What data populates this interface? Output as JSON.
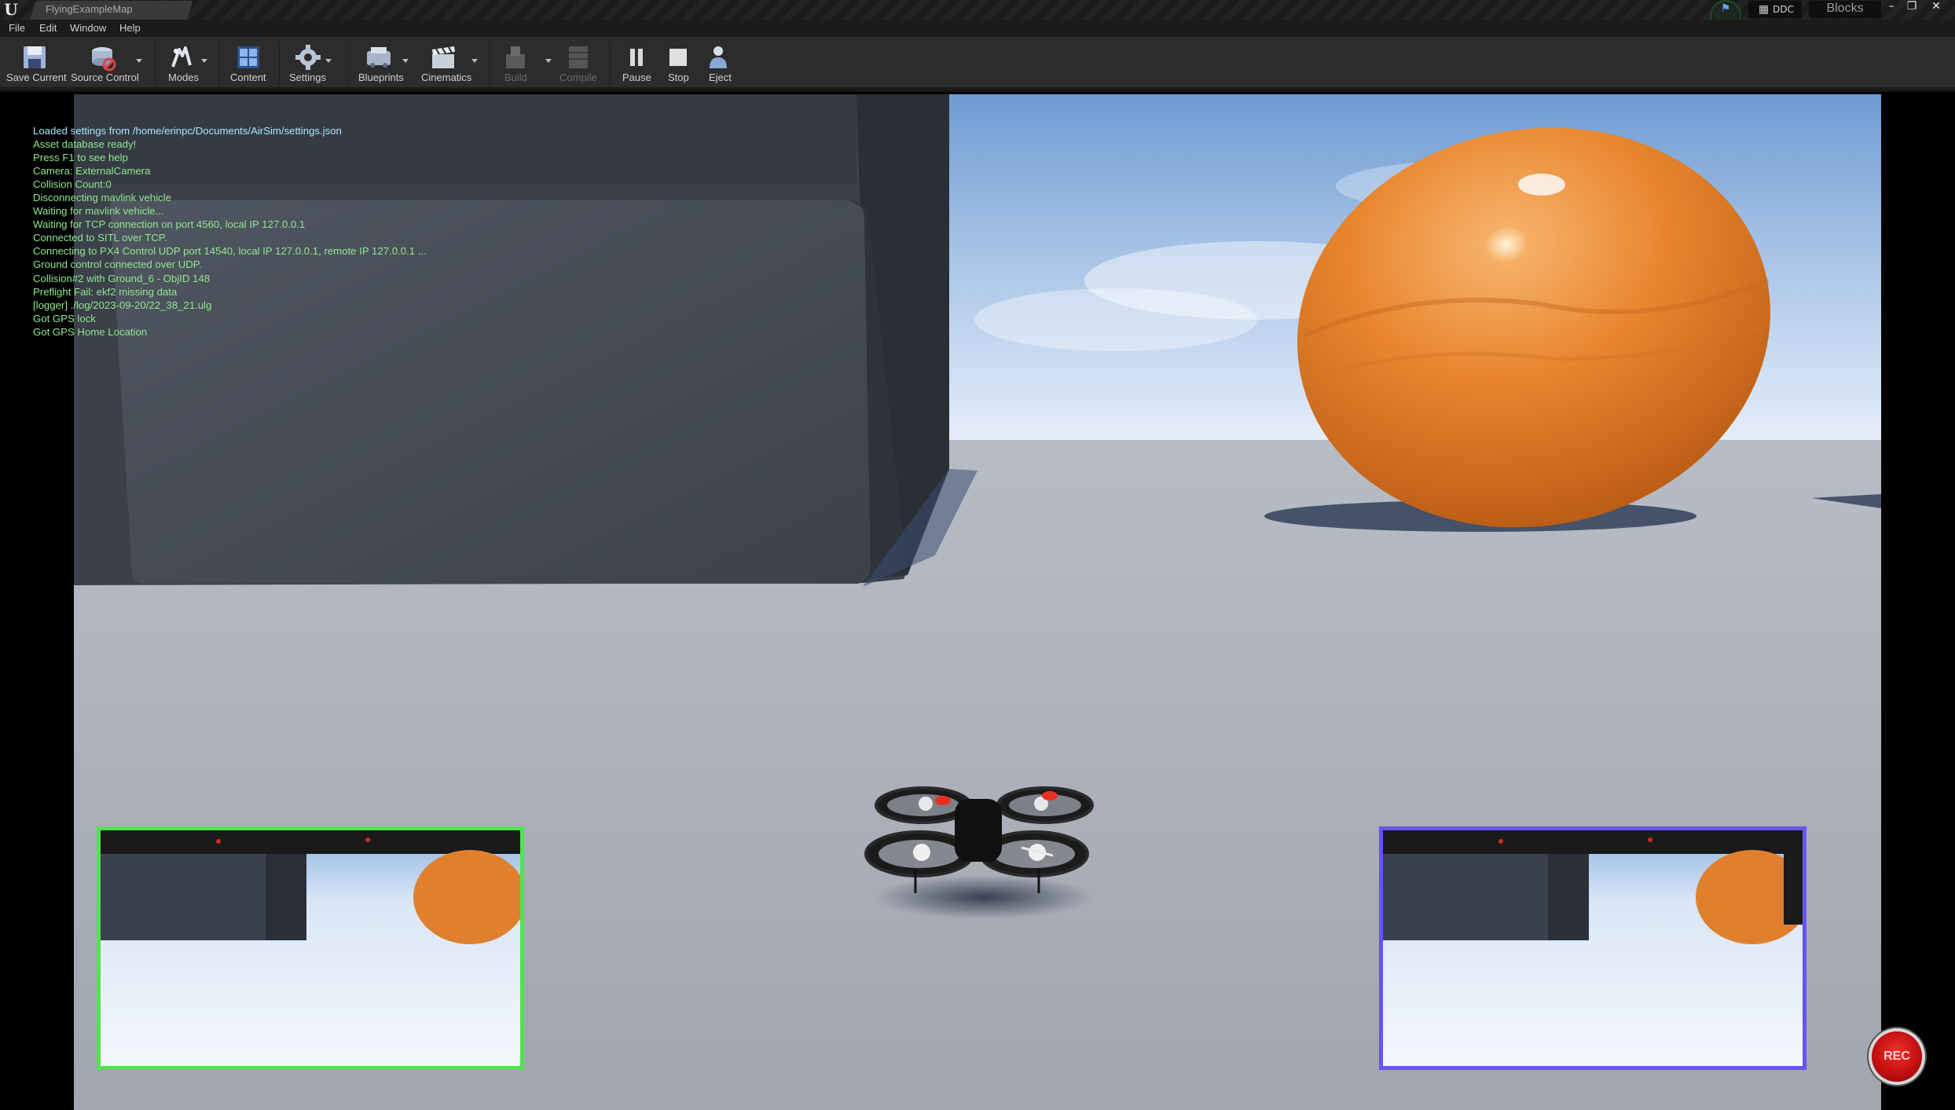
{
  "window": {
    "tab_title": "FlyingExampleMap",
    "ddc_label": "DDC",
    "project_name": "Blocks",
    "logo_icon": "unreal-engine-logo",
    "controls": [
      "minimize-icon",
      "restore-icon",
      "close-icon"
    ]
  },
  "menu": [
    "File",
    "Edit",
    "Window",
    "Help"
  ],
  "toolbar": {
    "save_current": "Save Current",
    "source_control": "Source Control",
    "modes": "Modes",
    "content": "Content",
    "settings": "Settings",
    "blueprints": "Blueprints",
    "cinematics": "Cinematics",
    "build": "Build",
    "compile": "Compile",
    "pause": "Pause",
    "stop": "Stop",
    "eject": "Eject"
  },
  "log_lines": [
    "Loaded settings from /home/erinpc/Documents/AirSim/settings.json",
    "Asset database ready!",
    "Press F1 to see help",
    "Camera: ExternalCamera",
    "Collision Count:0",
    "Disconnecting mavlink vehicle",
    "Waiting for mavlink vehicle...",
    "Waiting for TCP connection on port 4560, local IP 127.0.0.1",
    "Connected to SITL over TCP.",
    "Connecting to PX4 Control UDP port 14540, local IP 127.0.0.1, remote IP 127.0.0.1 ...",
    "Ground control connected over UDP.",
    "Collision#2 with Ground_6 - ObjID 148",
    "Preflight Fail: ekf2 missing data",
    "[logger] ./log/2023-09-20/22_38_21.ulg",
    "Got GPS lock",
    "Got GPS Home Location"
  ],
  "record_button": "REC",
  "colors": {
    "left_subview_border": "#55e055",
    "right_subview_border": "#6655ee",
    "log_text": "#90e890",
    "sphere": "#e8852e",
    "record": "#cc1010"
  }
}
